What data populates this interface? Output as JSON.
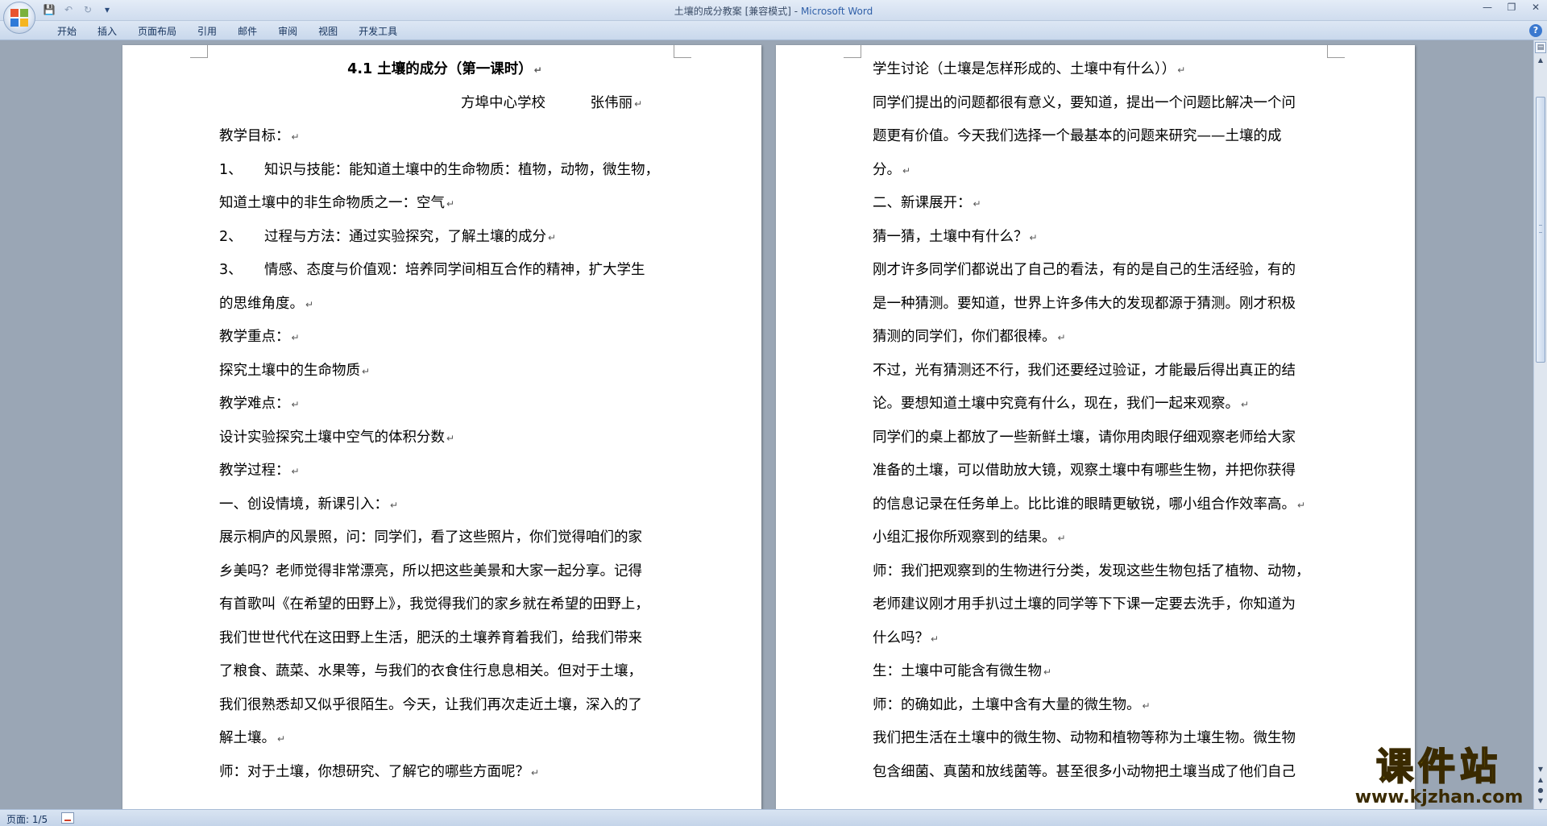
{
  "window": {
    "title": "土壤的成分教案 [兼容模式]",
    "app_name": "Microsoft Word",
    "separator": " - "
  },
  "ribbon": {
    "tabs": [
      "开始",
      "插入",
      "页面布局",
      "引用",
      "邮件",
      "审阅",
      "视图",
      "开发工具"
    ]
  },
  "icons": {
    "office_button": "office-logo-icon",
    "save": "save-icon",
    "undo": "undo-icon",
    "redo": "redo-icon",
    "customize": "customize-qat-icon",
    "help": "help-icon"
  },
  "status": {
    "page_count": "页面: 1/5"
  },
  "paragraph_mark": "↵",
  "left_page": {
    "title": "4.1 土壤的成分（第一课时）",
    "author": "方埠中心学校          张伟丽",
    "lines": [
      {
        "text": "教学目标：",
        "mark": true
      },
      {
        "num": "1、",
        "text": "知识与技能：能知道土壤中的生命物质：植物，动物，微生物，",
        "mark": false
      },
      {
        "text": "知道土壤中的非生命物质之一：空气",
        "mark": true
      },
      {
        "num": "2、",
        "text": "过程与方法：通过实验探究，了解土壤的成分",
        "mark": true
      },
      {
        "num": "3、",
        "text": "情感、态度与价值观：培养同学间相互合作的精神，扩大学生",
        "mark": false
      },
      {
        "text": "的思维角度。",
        "mark": true
      },
      {
        "text": "教学重点：",
        "mark": true
      },
      {
        "text": "探究土壤中的生命物质",
        "mark": true
      },
      {
        "text": "教学难点：",
        "mark": true
      },
      {
        "text": "设计实验探究土壤中空气的体积分数",
        "mark": true
      },
      {
        "text": "教学过程：",
        "mark": true
      },
      {
        "text": "一、创设情境，新课引入：",
        "mark": true
      },
      {
        "text": "展示桐庐的风景照，问：同学们，看了这些照片，你们觉得咱们的家",
        "mark": false
      },
      {
        "text": "乡美吗？老师觉得非常漂亮，所以把这些美景和大家一起分享。记得",
        "mark": false
      },
      {
        "text": "有首歌叫《在希望的田野上》，我觉得我们的家乡就在希望的田野上，",
        "mark": false
      },
      {
        "text": "我们世世代代在这田野上生活，肥沃的土壤养育着我们，给我们带来",
        "mark": false
      },
      {
        "text": "了粮食、蔬菜、水果等，与我们的衣食住行息息相关。但对于土壤，",
        "mark": false
      },
      {
        "text": "我们很熟悉却又似乎很陌生。今天，让我们再次走近土壤，深入的了",
        "mark": false
      },
      {
        "text": "解土壤。",
        "mark": true
      },
      {
        "text": "师：对于土壤，你想研究、了解它的哪些方面呢？",
        "mark": true
      }
    ]
  },
  "right_page": {
    "lines": [
      {
        "text": "学生讨论（土壤是怎样形成的、土壤中有什么））",
        "mark": true
      },
      {
        "text": "同学们提出的问题都很有意义，要知道，提出一个问题比解决一个问",
        "mark": false
      },
      {
        "text": "题更有价值。今天我们选择一个最基本的问题来研究——土壤的成",
        "mark": false
      },
      {
        "text": "分。",
        "mark": true
      },
      {
        "text": "二、新课展开：",
        "mark": true
      },
      {
        "text": "猜一猜，土壤中有什么？",
        "mark": true
      },
      {
        "text": "刚才许多同学们都说出了自己的看法，有的是自己的生活经验，有的",
        "mark": false
      },
      {
        "text": "是一种猜测。要知道，世界上许多伟大的发现都源于猜测。刚才积极",
        "mark": false
      },
      {
        "text": "猜测的同学们，你们都很棒。",
        "mark": true
      },
      {
        "text": "不过，光有猜测还不行，我们还要经过验证，才能最后得出真正的结",
        "mark": false
      },
      {
        "text": "论。要想知道土壤中究竟有什么，现在，我们一起来观察。",
        "mark": true
      },
      {
        "text": "同学们的桌上都放了一些新鲜土壤，请你用肉眼仔细观察老师给大家",
        "mark": false
      },
      {
        "text": "准备的土壤，可以借助放大镜，观察土壤中有哪些生物，并把你获得",
        "mark": false
      },
      {
        "text": "的信息记录在任务单上。比比谁的眼睛更敏锐，哪小组合作效率高。",
        "mark": true
      },
      {
        "text": "小组汇报你所观察到的结果。",
        "mark": true
      },
      {
        "text": "师：我们把观察到的生物进行分类，发现这些生物包括了植物、动物，",
        "mark": false
      },
      {
        "text": "老师建议刚才用手扒过土壤的同学等下下课一定要去洗手，你知道为",
        "mark": false
      },
      {
        "text": "什么吗？",
        "mark": true
      },
      {
        "text": "生：土壤中可能含有微生物",
        "mark": true
      },
      {
        "text": "师：的确如此，土壤中含有大量的微生物。",
        "mark": true
      },
      {
        "text": "我们把生活在土壤中的微生物、动物和植物等称为土壤生物。微生物",
        "mark": false
      },
      {
        "text": "包含细菌、真菌和放线菌等。甚至很多小动物把土壤当成了他们自己",
        "mark": false
      }
    ]
  },
  "watermark": {
    "title": "课件站",
    "url": "www.kjzhan.com"
  }
}
